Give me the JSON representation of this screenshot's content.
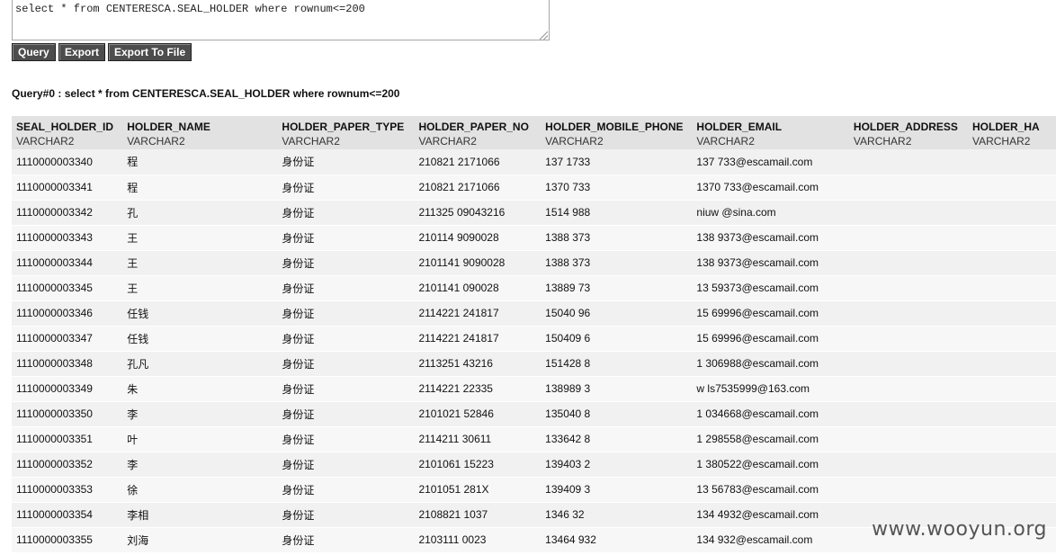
{
  "sql_editor": {
    "value": "select * from CENTERESCA.SEAL_HOLDER where rownum<=200"
  },
  "buttons": {
    "query": "Query",
    "export": "Export",
    "export_file": "Export To File"
  },
  "query_caption": "Query#0 : select * from CENTERESCA.SEAL_HOLDER where rownum<=200",
  "columns": [
    {
      "name": "SEAL_HOLDER_ID",
      "type": "VARCHAR2"
    },
    {
      "name": "HOLDER_NAME",
      "type": "VARCHAR2"
    },
    {
      "name": "HOLDER_PAPER_TYPE",
      "type": "VARCHAR2"
    },
    {
      "name": "HOLDER_PAPER_NO",
      "type": "VARCHAR2"
    },
    {
      "name": "HOLDER_MOBILE_PHONE",
      "type": "VARCHAR2"
    },
    {
      "name": "HOLDER_EMAIL",
      "type": "VARCHAR2"
    },
    {
      "name": "HOLDER_ADDRESS",
      "type": "VARCHAR2"
    },
    {
      "name": "HOLDER_HA",
      "type": "VARCHAR2"
    }
  ],
  "rows": [
    [
      "1110000003340",
      "程",
      "身份证",
      "210821 2171066",
      "137 1733",
      "137 733@escamail.com",
      "",
      ""
    ],
    [
      "1110000003341",
      "程",
      "身份证",
      "210821 2171066",
      "1370 733",
      "1370 733@escamail.com",
      "",
      ""
    ],
    [
      "1110000003342",
      "孔",
      "身份证",
      "211325 09043216",
      "1514 988",
      "niuw @sina.com",
      "",
      ""
    ],
    [
      "1110000003343",
      "王",
      "身份证",
      "210114 9090028",
      "1388 373",
      "138 9373@escamail.com",
      "",
      ""
    ],
    [
      "1110000003344",
      "王",
      "身份证",
      "2101141 9090028",
      "1388 373",
      "138 9373@escamail.com",
      "",
      ""
    ],
    [
      "1110000003345",
      "王",
      "身份证",
      "2101141 090028",
      "13889 73",
      "13 59373@escamail.com",
      "",
      ""
    ],
    [
      "1110000003346",
      "任钱",
      "身份证",
      "2114221 241817",
      "15040 96",
      "15 69996@escamail.com",
      "",
      ""
    ],
    [
      "1110000003347",
      "任钱",
      "身份证",
      "2114221 241817",
      "150409 6",
      "15 69996@escamail.com",
      "",
      ""
    ],
    [
      "1110000003348",
      "孔凡",
      "身份证",
      "2113251 43216",
      "151428 8",
      "1 306988@escamail.com",
      "",
      ""
    ],
    [
      "1110000003349",
      "朱",
      "身份证",
      "2114221 22335",
      "138989 3",
      "w ls7535999@163.com",
      "",
      ""
    ],
    [
      "1110000003350",
      "李",
      "身份证",
      "2101021 52846",
      "135040 8",
      "1 034668@escamail.com",
      "",
      ""
    ],
    [
      "1110000003351",
      "叶",
      "身份证",
      "2114211 30611",
      "133642 8",
      "1 298558@escamail.com",
      "",
      ""
    ],
    [
      "1110000003352",
      "李",
      "身份证",
      "2101061 15223",
      "139403 2",
      "1 380522@escamail.com",
      "",
      ""
    ],
    [
      "1110000003353",
      "徐",
      "身份证",
      "2101051 281X",
      "139409 3",
      "13 56783@escamail.com",
      "",
      ""
    ],
    [
      "1110000003354",
      "李相",
      "身份证",
      "2108821 1037",
      "1346 32",
      "134 4932@escamail.com",
      "",
      ""
    ],
    [
      "1110000003355",
      "刘海",
      "身份证",
      "2103111 0023",
      "13464 932",
      "134 932@escamail.com",
      "",
      ""
    ]
  ],
  "watermark": "www.wooyun.org"
}
